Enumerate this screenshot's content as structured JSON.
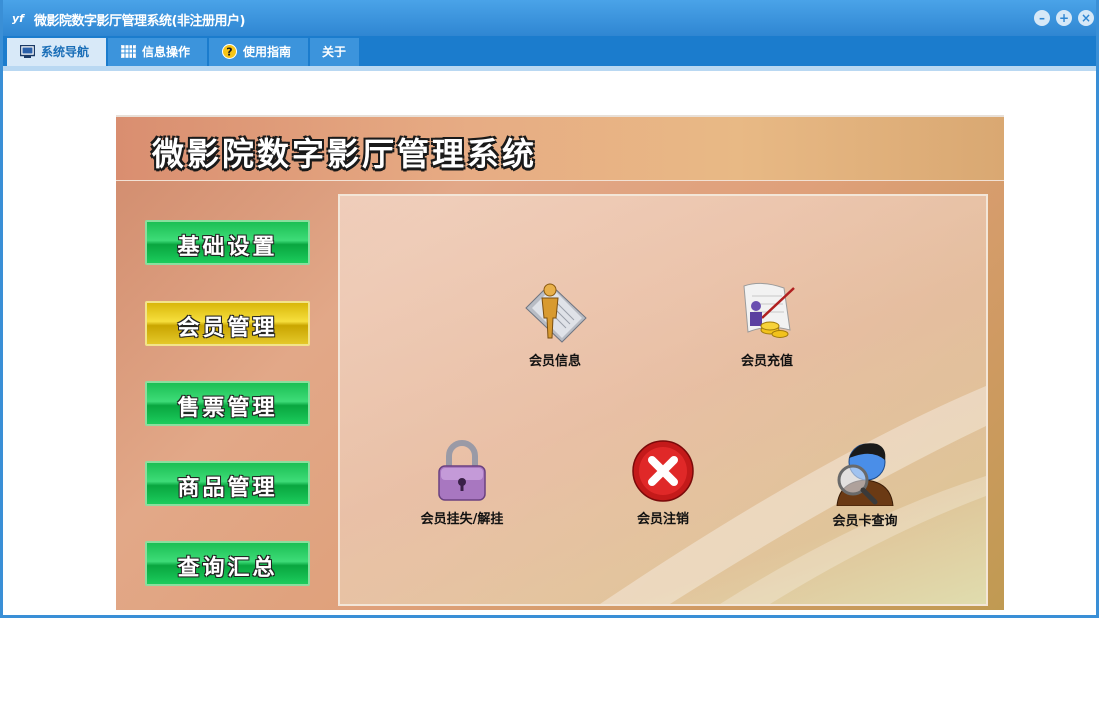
{
  "window": {
    "title": "微影院数字影厅管理系统(非注册用户)",
    "app_icon": "yf",
    "controls": [
      "minimize-icon",
      "restore-icon",
      "close-icon"
    ]
  },
  "tabs": [
    {
      "label": "系统导航",
      "icon": "monitor-icon",
      "active": true
    },
    {
      "label": "信息操作",
      "icon": "grid-icon",
      "active": false
    },
    {
      "label": "使用指南",
      "icon": "help-icon",
      "active": false
    },
    {
      "label": "关于",
      "icon": "",
      "active": false
    }
  ],
  "panel": {
    "title": "微影院数字影厅管理系统"
  },
  "sidebar": {
    "items": [
      {
        "label": "基础设置",
        "active": false
      },
      {
        "label": "会员管理",
        "active": true
      },
      {
        "label": "售票管理",
        "active": false
      },
      {
        "label": "商品管理",
        "active": false
      },
      {
        "label": "查询汇总",
        "active": false
      }
    ]
  },
  "functions": {
    "items": [
      {
        "label": "会员信息",
        "icon": "member-info-icon"
      },
      {
        "label": "会员充值",
        "icon": "member-recharge-icon"
      },
      {
        "label": "会员挂失/解挂",
        "icon": "lock-icon"
      },
      {
        "label": "会员注销",
        "icon": "cancel-icon"
      },
      {
        "label": "会员卡查询",
        "icon": "member-search-icon"
      }
    ]
  },
  "colors": {
    "titlebar": "#3a8fd6",
    "tabbar": "#1b7ccd",
    "button_green": "#1ccc5c",
    "button_active_yellow": "#f6df3d"
  }
}
